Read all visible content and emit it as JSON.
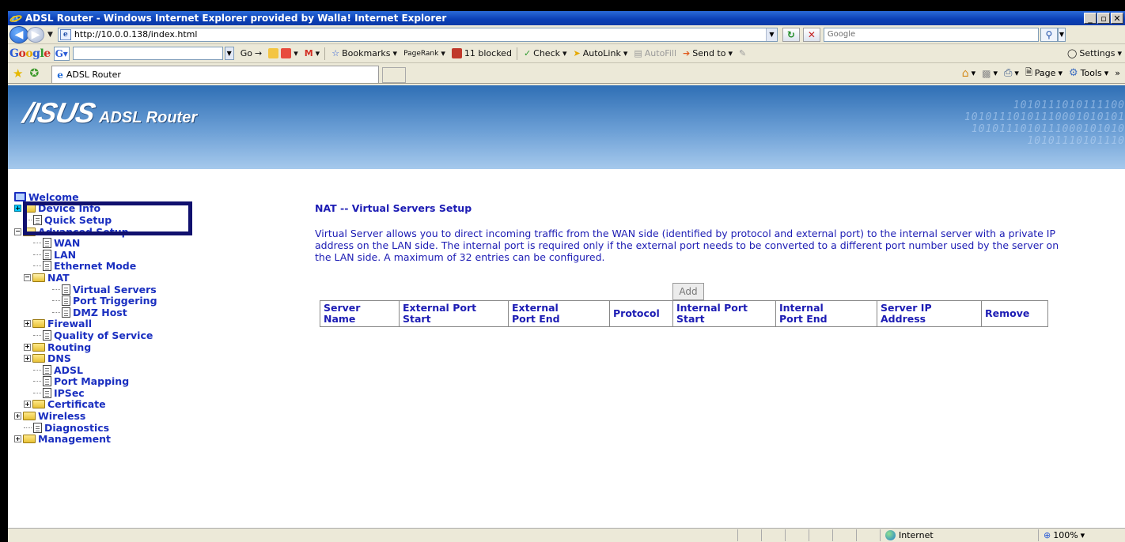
{
  "browser": {
    "title": "ADSL Router - Windows Internet Explorer provided by Walla! Internet Explorer",
    "window_buttons": [
      "_",
      "▫",
      "✕"
    ],
    "url": "http://10.0.0.138/index.html",
    "search_placeholder": "Google",
    "tab_title": "ADSL Router"
  },
  "google_toolbar": {
    "logo": [
      "G",
      "o",
      "o",
      "g",
      "l",
      "e"
    ],
    "go": "Go",
    "bookmarks": "Bookmarks",
    "pagerank": "PageRank",
    "blocked": "11 blocked",
    "check": "Check",
    "autolink": "AutoLink",
    "autofill": "AutoFill",
    "sendto": "Send to",
    "settings": "Settings"
  },
  "command_bar": {
    "page": "Page",
    "tools": "Tools"
  },
  "banner": {
    "brand": "/ISUS",
    "product": "ADSL Router",
    "binary_lines": [
      "1010111010111100",
      "10101110101110001010101",
      "1010111010111000101010",
      "10101110101110"
    ]
  },
  "sidebar": {
    "welcome": "Welcome",
    "device_info": "Device Info",
    "quick_setup": "Quick Setup",
    "advanced_setup": "Advanced Setup",
    "wan": "WAN",
    "lan": "LAN",
    "ethernet_mode": "Ethernet Mode",
    "nat": "NAT",
    "virtual_servers": "Virtual Servers",
    "port_triggering": "Port Triggering",
    "dmz_host": "DMZ Host",
    "firewall": "Firewall",
    "qos": "Quality of Service",
    "routing": "Routing",
    "dns": "DNS",
    "adsl": "ADSL",
    "port_mapping": "Port Mapping",
    "ipsec": "IPSec",
    "certificate": "Certificate",
    "wireless": "Wireless",
    "diagnostics": "Diagnostics",
    "management": "Management"
  },
  "content": {
    "heading": "NAT -- Virtual Servers Setup",
    "description": "Virtual Server allows you to direct incoming traffic from the WAN side (identified by protocol and external port) to the internal server with a private IP address on the LAN side. The internal port is required only if the external port needs to be converted to a different port number used by the server on the LAN side. A maximum of 32 entries can be configured.",
    "add_button": "Add",
    "columns": [
      [
        "Server",
        "Name"
      ],
      [
        "External Port",
        "Start"
      ],
      [
        "External",
        "Port End"
      ],
      [
        "Protocol",
        ""
      ],
      [
        "Internal Port",
        "Start"
      ],
      [
        "Internal",
        "Port End"
      ],
      [
        "Server IP",
        "Address"
      ],
      [
        "Remove",
        ""
      ]
    ]
  },
  "status": {
    "zone": "Internet",
    "zoom": "100%"
  }
}
